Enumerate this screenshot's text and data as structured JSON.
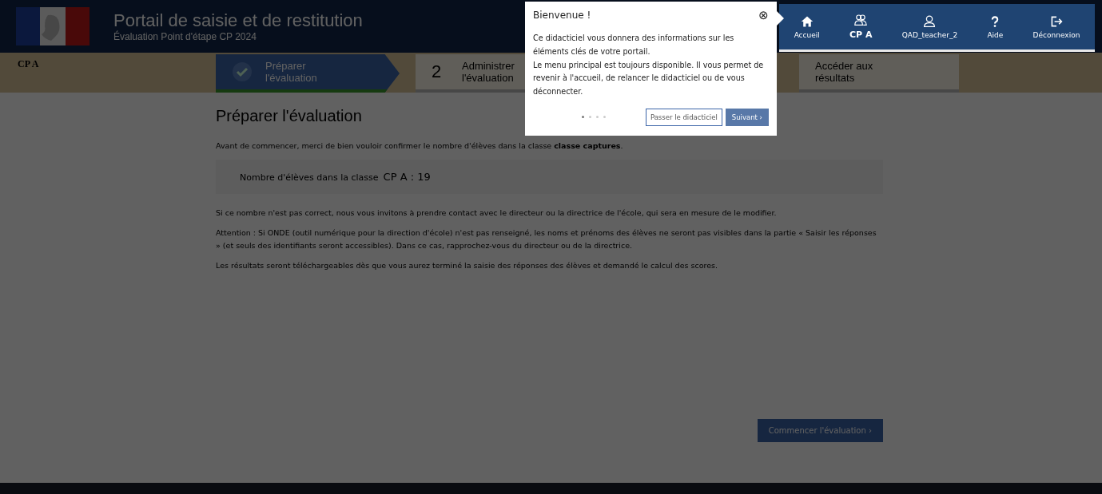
{
  "header": {
    "title": "Portail de saisie et de restitution",
    "subtitle": "Évaluation Point d'étape CP 2024"
  },
  "nav": [
    {
      "label": "Accueil",
      "kind": "home"
    },
    {
      "label": "CP A",
      "kind": "class"
    },
    {
      "label": "QAD_teacher_2",
      "kind": "user"
    },
    {
      "label": "Aide",
      "kind": "help"
    },
    {
      "label": "Déconnexion",
      "kind": "logout"
    }
  ],
  "class_label": "CP A",
  "steps": [
    {
      "label": "Préparer l'évaluation",
      "done": true
    },
    {
      "label": "Administrer l'évaluation",
      "number": "2",
      "done": false
    },
    {
      "label": "Accéder aux résultats",
      "done": false
    }
  ],
  "content": {
    "title": "Préparer l'évaluation",
    "intro": "Avant de commencer, merci de bien vouloir confirmer le nombre d'élèves dans la classe **classe captures**.",
    "count_label": "Nombre d'élèves dans la classe",
    "count_value": "CP A : 19",
    "paragraphs": [
      "Si ce nombre n'est pas correct, nous vous invitons à prendre contact avec le directeur ou la directrice de l'école, qui sera en mesure de le modifier.",
      "Attention : Si ONDE (outil numérique pour la direction d'école) n'est pas renseigné, les noms et prénoms des élèves ne seront pas visibles dans la partie « Saisir les réponses » (et seuls des identifiants seront accessibles). Dans ce cas, rapprochez-vous du directeur ou de la directrice.",
      "Les résultats seront téléchargeables dès que vous aurez terminé la saisie des réponses des élèves et demandé le calcul des scores."
    ],
    "button": "Commencer l'évaluation ›"
  },
  "tour": {
    "title": "Bienvenue !",
    "close": "⊗",
    "text": "Ce didacticiel vous donnera des informations sur les éléments clés de votre portail.\nLe menu principal est toujours disponible. Il vous permet de revenir à l'accueil, de relancer le didacticiel ou de vous déconnecter.",
    "dots": [
      {
        "selected": true
      },
      {
        "selected": false
      },
      {
        "selected": false
      },
      {
        "selected": false
      }
    ],
    "skip": "Passer le didacticiel",
    "next": "Suivant ›"
  }
}
